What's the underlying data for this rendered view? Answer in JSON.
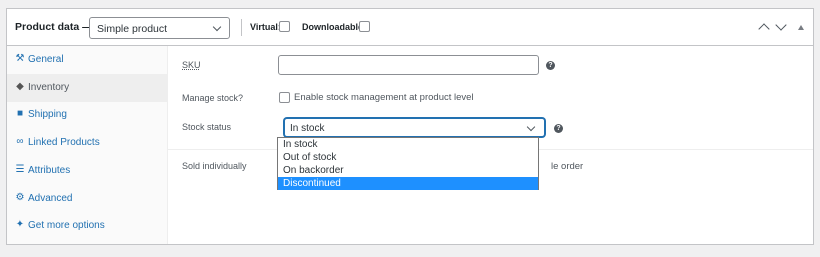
{
  "header": {
    "title": "Product data —",
    "product_type": "Simple product",
    "virtual_label": "Virtual:",
    "downloadable_label": "Downloadable:"
  },
  "sidebar": {
    "items": [
      {
        "label": "General",
        "icon": "wrench-icon"
      },
      {
        "label": "Inventory",
        "icon": "tag-icon",
        "active": true
      },
      {
        "label": "Shipping",
        "icon": "truck-icon"
      },
      {
        "label": "Linked Products",
        "icon": "link-icon"
      },
      {
        "label": "Attributes",
        "icon": "list-icon"
      },
      {
        "label": "Advanced",
        "icon": "gear-icon"
      },
      {
        "label": "Get more options",
        "icon": "plugin-icon"
      }
    ]
  },
  "inventory": {
    "sku_label": "SKU",
    "sku_value": "",
    "manage_stock_label": "Manage stock?",
    "manage_stock_desc": "Enable stock management at product level",
    "stock_status_label": "Stock status",
    "stock_status_value": "In stock",
    "sold_individually_label": "Sold individually",
    "sold_individually_desc_tail": "le order"
  },
  "stock_options": [
    "In stock",
    "Out of stock",
    "On backorder",
    "Discontinued"
  ],
  "highlighted_option": "Discontinued",
  "colors": {
    "accent": "#2271b1",
    "highlight": "#1e90ff"
  }
}
